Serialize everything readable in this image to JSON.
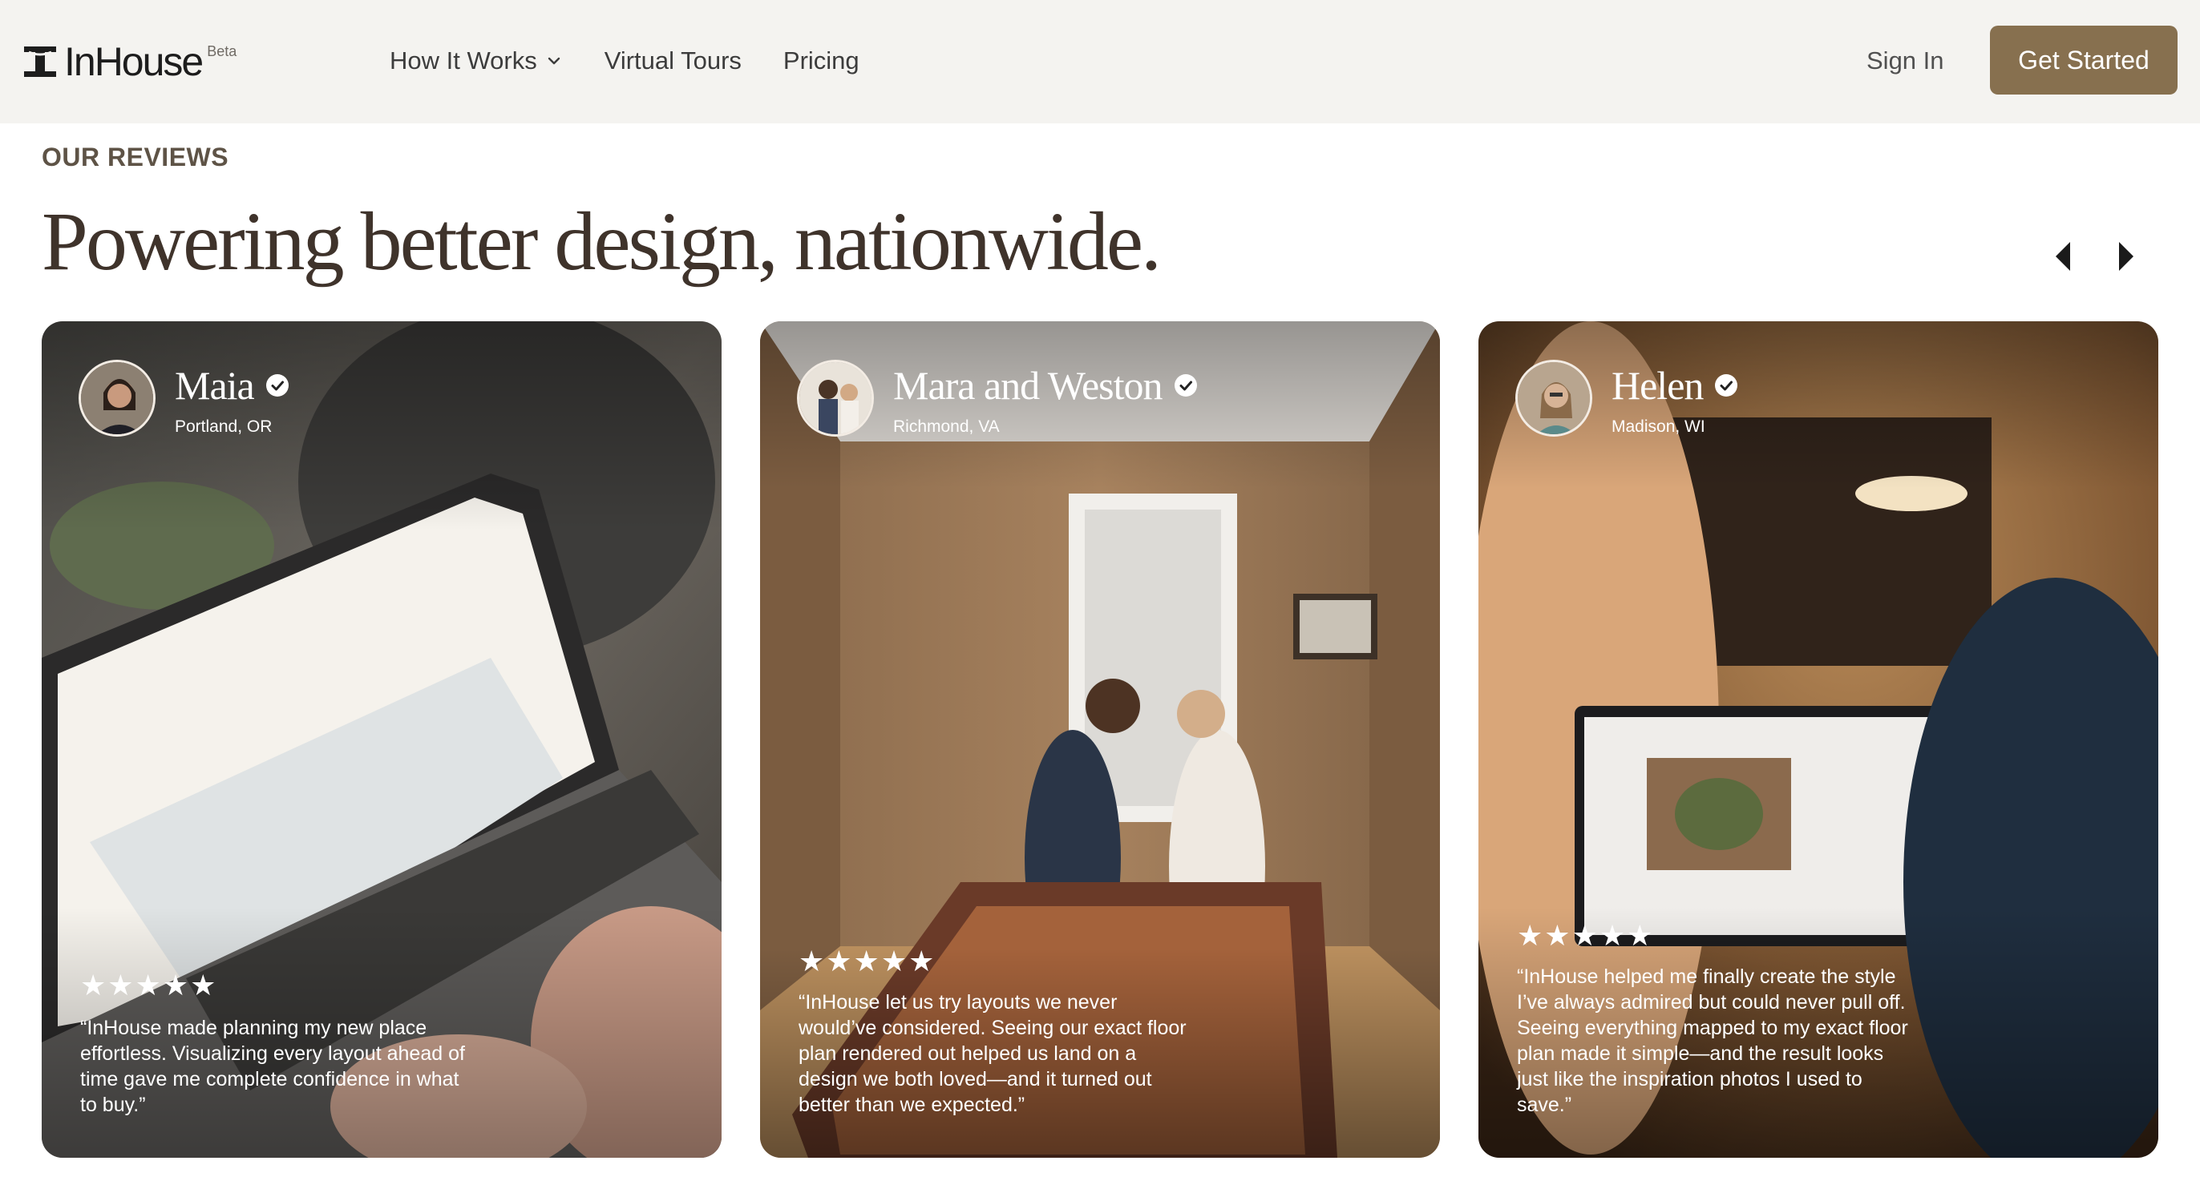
{
  "nav": {
    "logo_text": "InHouse",
    "beta_label": "Beta",
    "links": [
      {
        "label": "How It Works",
        "has_dropdown": true
      },
      {
        "label": "Virtual Tours"
      },
      {
        "label": "Pricing"
      }
    ],
    "sign_in": "Sign In",
    "get_started": "Get Started"
  },
  "section": {
    "eyebrow": "OUR REVIEWS",
    "headline": "Powering better design, nationwide.",
    "prev_icon": "caret-left-icon",
    "next_icon": "caret-right-icon"
  },
  "reviews": [
    {
      "name": "Maia",
      "location": "Portland, OR",
      "stars": "★★★★★",
      "rating": 5,
      "quote": "“InHouse made planning my new place effortless. Visualizing every layout ahead of time gave me complete confidence in what to buy.”"
    },
    {
      "name": "Mara and Weston",
      "location": "Richmond, VA",
      "stars": "★★★★★",
      "rating": 5,
      "quote": "“InHouse let us try layouts we never would’ve considered. Seeing our exact floor plan rendered out helped us land on a design we both loved—and it turned out better than we expected.”"
    },
    {
      "name": "Helen",
      "location": "Madison, WI",
      "stars": "★★★★★",
      "rating": 5,
      "quote": "“InHouse helped me finally create the style I’ve always admired but could never pull off. Seeing everything mapped to my exact floor plan made it simple—and the result looks just like the inspiration photos I used to save.”"
    }
  ],
  "colors": {
    "nav_bg": "#f4f3f0",
    "accent": "#87704f",
    "heading": "#3f332b"
  }
}
